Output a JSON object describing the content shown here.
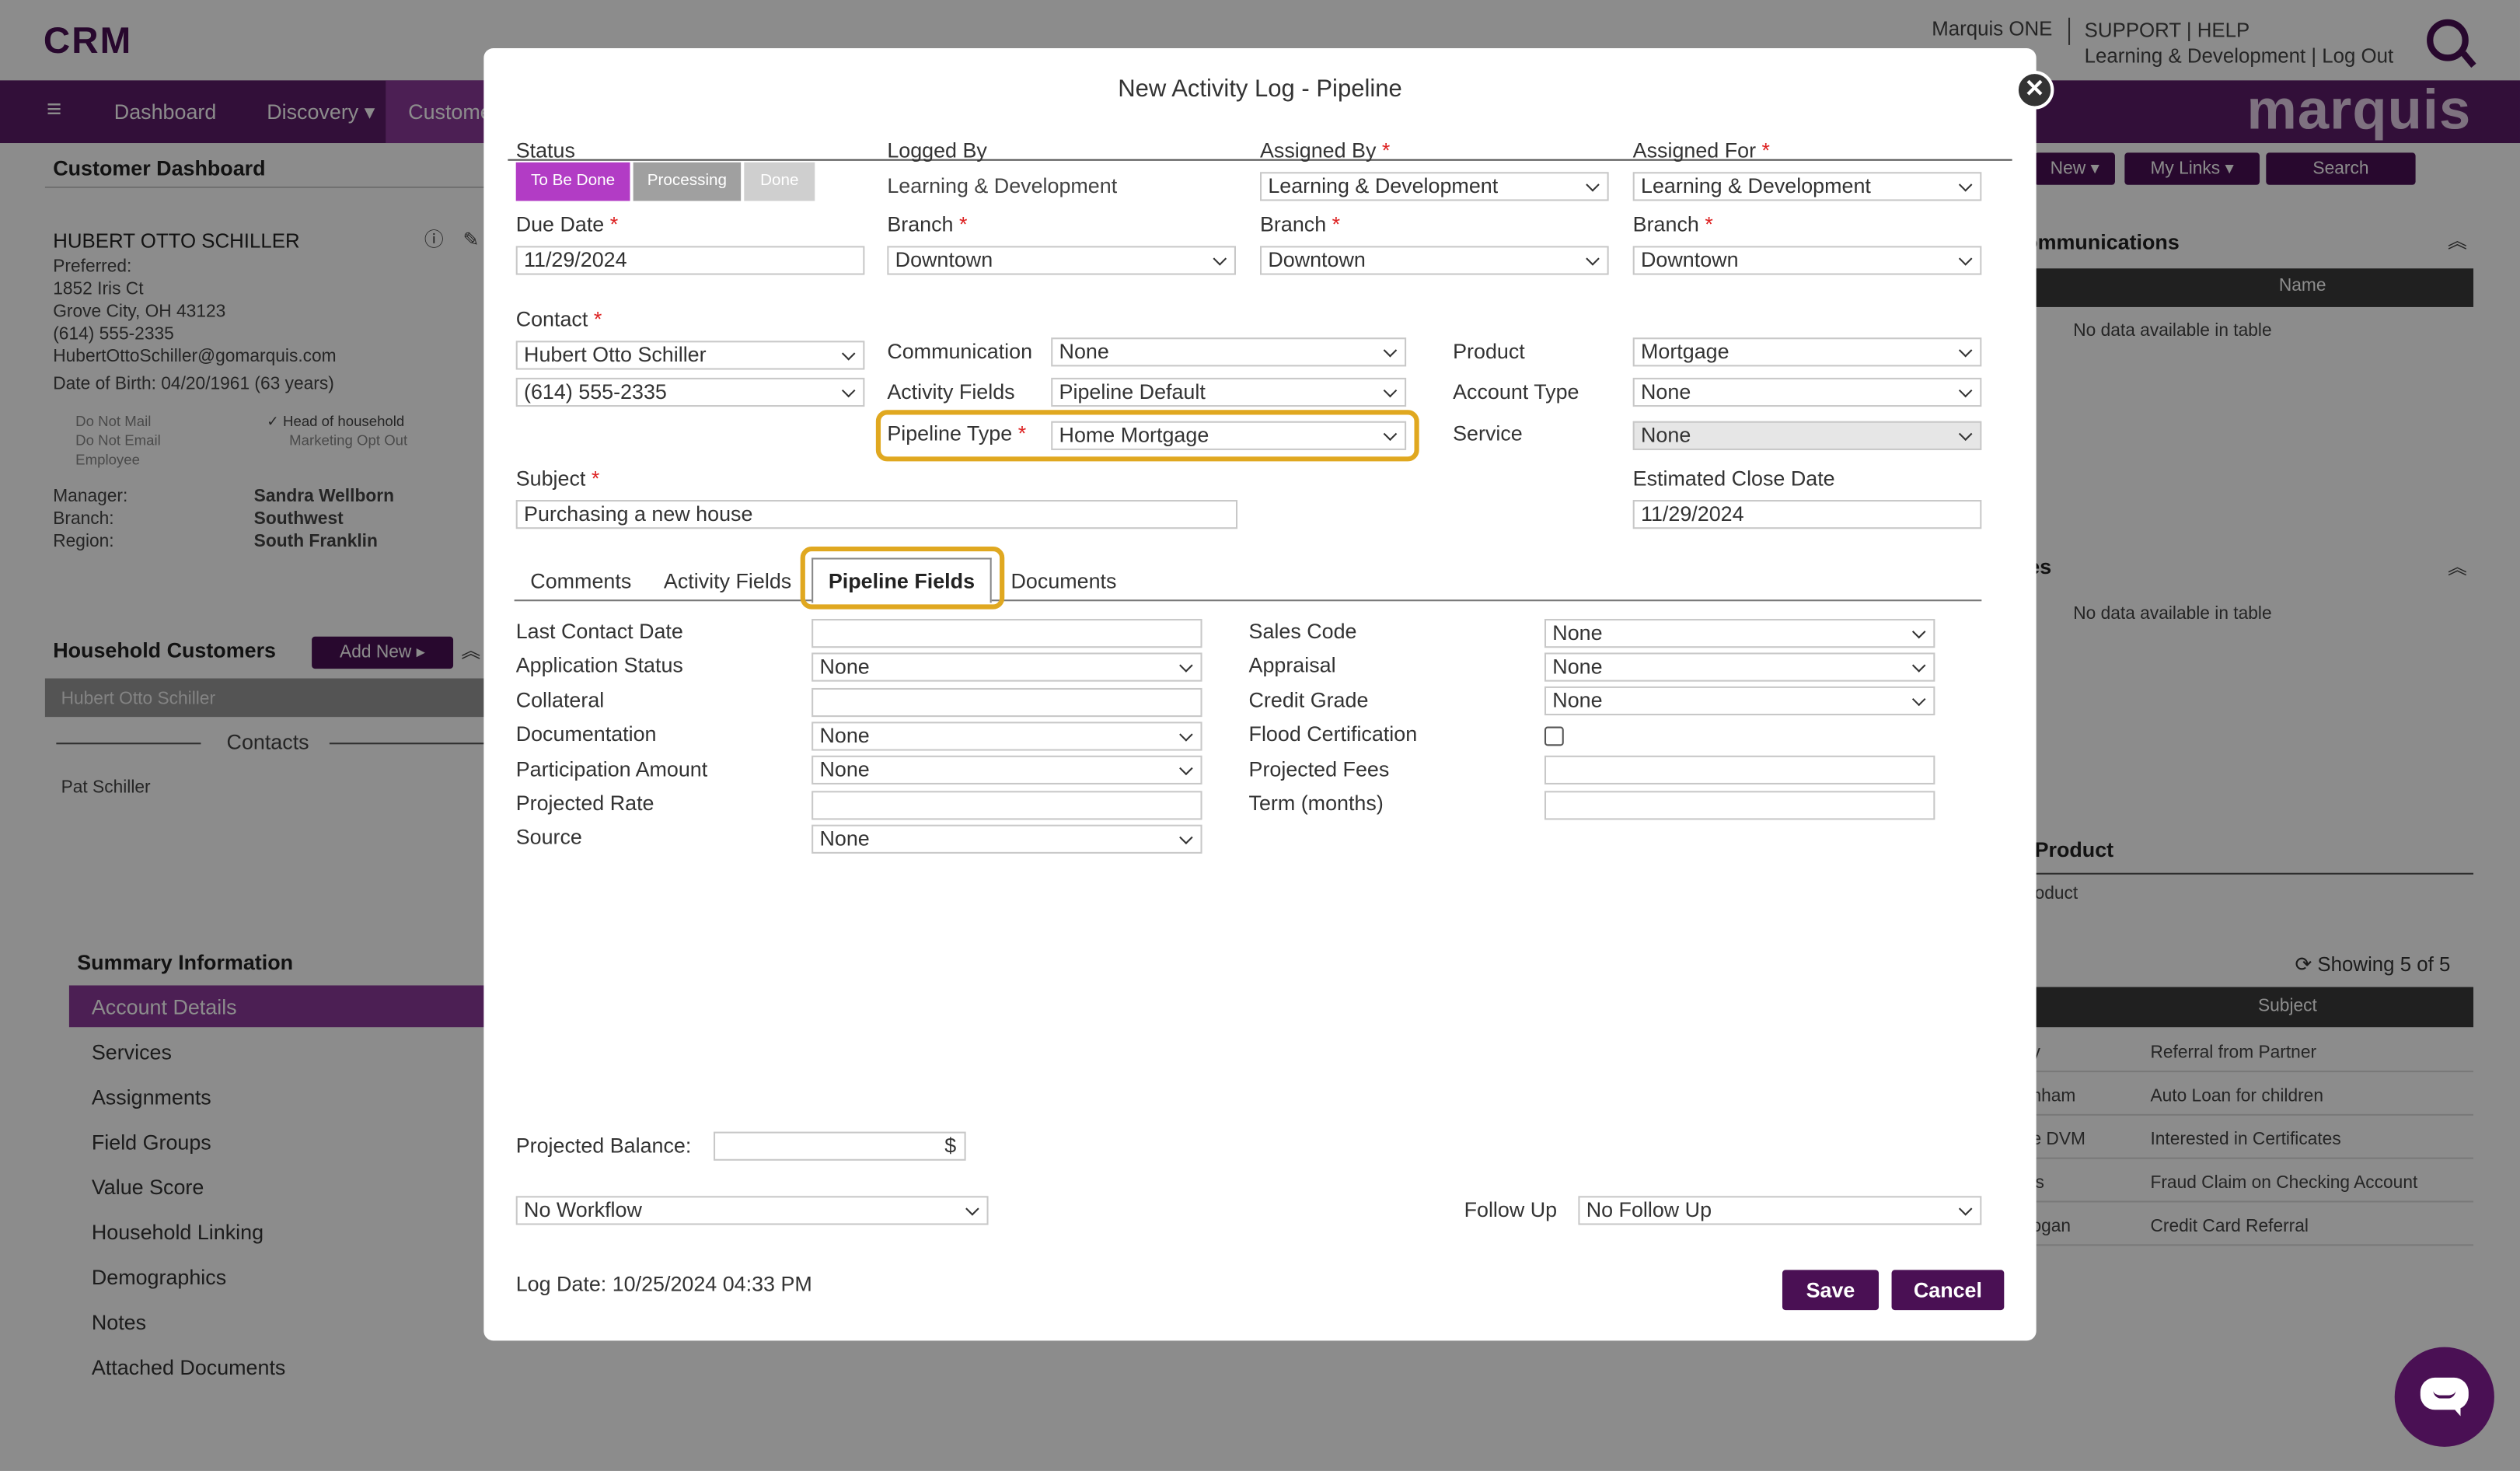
{
  "app": {
    "logo": "CRM",
    "brand": "marquis",
    "user": "Marquis ONE",
    "top_links_line1": "SUPPORT | HELP",
    "top_links_line2": "Learning & Development | Log Out",
    "nav": [
      "Dashboard",
      "Discovery",
      "Customers"
    ],
    "nav_buttons": [
      "New",
      "My Links",
      "Search"
    ]
  },
  "customer": {
    "panel_title": "Customer Dashboard",
    "name": "HUBERT OTTO SCHILLER",
    "preferred": "Preferred:",
    "address1": "1852 Iris Ct",
    "address2": "Grove City, OH 43123",
    "phone": "(614) 555-2335",
    "email": "HubertOttoSchiller@gomarquis.com",
    "dob": "Date of Birth: 04/20/1961 (63 years)",
    "flags": [
      "Do Not Mail",
      "Do Not Email",
      "Employee",
      "Head of household",
      "Marketing Opt Out"
    ],
    "manager_label": "Manager:",
    "manager": "Sandra Wellborn",
    "branch_label": "Branch:",
    "branch": "Southwest",
    "region_label": "Region:",
    "region": "South Franklin"
  },
  "household": {
    "title": "Household Customers",
    "add_new": "Add New",
    "selected": "Hubert Otto Schiller",
    "contacts_label": "Contacts",
    "contact": "Pat Schiller"
  },
  "summary": {
    "title": "Summary Information",
    "items": [
      "Account Details",
      "Services",
      "Assignments",
      "Field Groups",
      "Value Score",
      "Household Linking",
      "Demographics",
      "Notes",
      "Attached Documents"
    ]
  },
  "right_panels": {
    "communications_title": "ommunications",
    "name_col": "Name",
    "no_data": "No data available in table",
    "second_title": "es",
    "product_title": "Product",
    "product_sub": "oduct",
    "showing": "Showing 5 of 5",
    "subject_col": "Subject",
    "rows": [
      {
        "left": "y",
        "subject": "Referral from Partner"
      },
      {
        "left": "nham",
        "subject": "Auto Loan for children"
      },
      {
        "left": "e DVM",
        "subject": "Interested in Certificates"
      },
      {
        "left": "ls",
        "subject": "Fraud Claim on Checking Account"
      },
      {
        "left": "ogan",
        "subject": "Credit Card Referral"
      }
    ]
  },
  "modal": {
    "title": "New Activity Log - Pipeline",
    "status_label": "Status",
    "status_buttons": [
      "To Be Done",
      "Processing",
      "Done"
    ],
    "logged_by_label": "Logged By",
    "logged_by": "Learning & Development",
    "assigned_by_label": "Assigned By",
    "assigned_by": "Learning & Development",
    "assigned_for_label": "Assigned For",
    "assigned_for": "Learning & Development",
    "due_date_label": "Due Date",
    "due_date": "11/29/2024",
    "branch_label": "Branch",
    "branch_logged": "Downtown",
    "branch_assigned_by": "Downtown",
    "branch_assigned_for": "Downtown",
    "contact_label": "Contact",
    "contact_name": "Hubert Otto Schiller",
    "contact_phone": "(614) 555-2335",
    "communication_label": "Communication",
    "communication": "None",
    "activity_fields_label": "Activity Fields",
    "activity_fields": "Pipeline Default",
    "pipeline_type_label": "Pipeline Type",
    "pipeline_type": "Home Mortgage",
    "product_label": "Product",
    "product": "Mortgage",
    "account_type_label": "Account Type",
    "account_type": "None",
    "service_label": "Service",
    "service": "None",
    "subject_label": "Subject",
    "subject": "Purchasing a new house",
    "est_close_label": "Estimated Close Date",
    "est_close": "11/29/2024",
    "tabs": [
      "Comments",
      "Activity Fields",
      "Pipeline Fields",
      "Documents"
    ],
    "left_fields": [
      {
        "label": "Last Contact Date",
        "value": ""
      },
      {
        "label": "Application Status",
        "value": "None"
      },
      {
        "label": "Collateral",
        "value": ""
      },
      {
        "label": "Documentation",
        "value": "None"
      },
      {
        "label": "Participation Amount",
        "value": "None"
      },
      {
        "label": "Projected Rate",
        "value": ""
      },
      {
        "label": "Source",
        "value": "None"
      }
    ],
    "right_fields": [
      {
        "label": "Sales Code",
        "value": "None"
      },
      {
        "label": "Appraisal",
        "value": "None"
      },
      {
        "label": "Credit Grade",
        "value": "None"
      },
      {
        "label": "Flood Certification",
        "value": ""
      },
      {
        "label": "Projected Fees",
        "value": ""
      },
      {
        "label": "Term (months)",
        "value": ""
      }
    ],
    "projected_balance_label": "Projected Balance:",
    "currency": "$",
    "workflow": "No Workflow",
    "follow_up_label": "Follow Up",
    "follow_up": "No Follow Up",
    "log_date": "Log Date: 10/25/2024 04:33 PM",
    "save": "Save",
    "cancel": "Cancel",
    "close": "✕"
  },
  "colors": {
    "brand_purple": "#5c1d68",
    "accent_purple": "#8b3a9a",
    "highlight": "#e0a820",
    "dark_button": "#4a1054"
  }
}
